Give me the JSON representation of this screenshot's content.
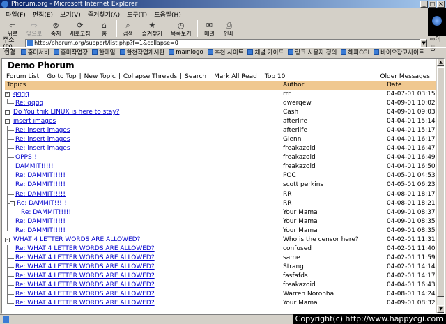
{
  "window": {
    "title": "Phorum.org - Microsoft Internet Explorer",
    "min": "_",
    "max": "□",
    "close": "×"
  },
  "menu": [
    "파일(F)",
    "편집(E)",
    "보기(V)",
    "즐겨찾기(A)",
    "도구(T)",
    "도움말(H)"
  ],
  "toolbar": {
    "back": "뒤로",
    "forward": "앞으로",
    "stop": "중지",
    "refresh": "새로고침",
    "home": "홈",
    "search": "검색",
    "favorites": "즐겨찾기",
    "history": "목록보기",
    "mail": "메일",
    "print": "인쇄"
  },
  "address": {
    "label": "주소(D)",
    "url": "http://phorum.org/support/list.php?f=1&collapse=0",
    "go": "이동"
  },
  "links": {
    "label": "연결",
    "items": [
      "홈미서비",
      "홈미작업장",
      "한메일",
      "한천작업게시판",
      "mainlogo",
      "추천 사이트",
      "채널 가이드",
      "링크 사용자 정의",
      "해피CGI",
      "바이오참고사이트"
    ]
  },
  "forum": {
    "title": "Demo Phorum",
    "nav": [
      "Forum List",
      "Go to Top",
      "New Topic",
      "Collapse Threads",
      "Search",
      "Mark All Read",
      "Top 10"
    ],
    "older": "Older Messages",
    "headers": {
      "topics": "Topics",
      "author": "Author",
      "date": "Date"
    }
  },
  "messages": [
    {
      "topic": "qqqq",
      "author": "rrr",
      "date": "04-07-01 03:15",
      "depth": 0,
      "box": "-"
    },
    {
      "topic": "Re: qqqq",
      "author": "qwerqew",
      "date": "04-09-01 10:02",
      "depth": 1
    },
    {
      "topic": "Do You thik LINUX is here to stay?",
      "author": "Cash",
      "date": "04-09-01 09:03",
      "depth": 0,
      "box": ""
    },
    {
      "topic": "insert images",
      "author": "afterlife",
      "date": "04-04-01 15:14",
      "depth": 0,
      "box": "-"
    },
    {
      "topic": "Re: insert images",
      "author": "afterlife",
      "date": "04-04-01 15:17",
      "depth": 1
    },
    {
      "topic": "Re: insert images",
      "author": "Glenn",
      "date": "04-04-01 16:17",
      "depth": 1
    },
    {
      "topic": "Re: insert images",
      "author": "freakazoid",
      "date": "04-04-01 16:47",
      "depth": 1
    },
    {
      "topic": "OPPS!!",
      "author": "freakazoid",
      "date": "04-04-01 16:49",
      "depth": 1
    },
    {
      "topic": "DAMMIT!!!!!",
      "author": "freakazoid",
      "date": "04-04-01 16:50",
      "depth": 1
    },
    {
      "topic": "Re: DAMMIT!!!!!",
      "author": "POC",
      "date": "04-05-01 04:53",
      "depth": 1
    },
    {
      "topic": "Re: DAMMIT!!!!!",
      "author": "scott perkins",
      "date": "04-05-01 06:23",
      "depth": 1
    },
    {
      "topic": "Re: DAMMIT!!!!!",
      "author": "RR",
      "date": "04-08-01 18:17",
      "depth": 1
    },
    {
      "topic": "Re: DAMMIT!!!!!",
      "author": "RR",
      "date": "04-08-01 18:21",
      "depth": 1,
      "box": "-"
    },
    {
      "topic": "Re: DAMMIT!!!!!",
      "author": "Your Mama",
      "date": "04-09-01 08:37",
      "depth": 2
    },
    {
      "topic": "Re: DAMMIT!!!!!",
      "author": "Your Mama",
      "date": "04-09-01 08:35",
      "depth": 1
    },
    {
      "topic": "Re: DAMMIT!!!!!",
      "author": "Your Mama",
      "date": "04-09-01 08:35",
      "depth": 1
    },
    {
      "topic": "WHAT 4 LETTER WORDS ARE ALLOWED?",
      "author": "Who is the censor here?",
      "date": "04-02-01 11:31",
      "depth": 0,
      "box": "-"
    },
    {
      "topic": "Re: WHAT 4 LETTER WORDS ARE ALLOWED?",
      "author": "confused",
      "date": "04-02-01 11:40",
      "depth": 1
    },
    {
      "topic": "Re: WHAT 4 LETTER WORDS ARE ALLOWED?",
      "author": "same",
      "date": "04-02-01 11:59",
      "depth": 1
    },
    {
      "topic": "Re: WHAT 4 LETTER WORDS ARE ALLOWED?",
      "author": "Strang",
      "date": "04-02-01 14:14",
      "depth": 1
    },
    {
      "topic": "Re: WHAT 4 LETTER WORDS ARE ALLOWED?",
      "author": "fasfafds",
      "date": "04-02-01 14:17",
      "depth": 1
    },
    {
      "topic": "Re: WHAT 4 LETTER WORDS ARE ALLOWED?",
      "author": "freakazoid",
      "date": "04-04-01 16:43",
      "depth": 1
    },
    {
      "topic": "Re: WHAT 4 LETTER WORDS ARE ALLOWED?",
      "author": "Warren Noronha",
      "date": "04-08-01 14:24",
      "depth": 1
    },
    {
      "topic": "Re: WHAT 4 LETTER WORDS ARE ALLOWED?",
      "author": "Your Mama",
      "date": "04-09-01 08:32",
      "depth": 1
    }
  ],
  "watermark": "Copyright(c) http://www.happycgi.com"
}
